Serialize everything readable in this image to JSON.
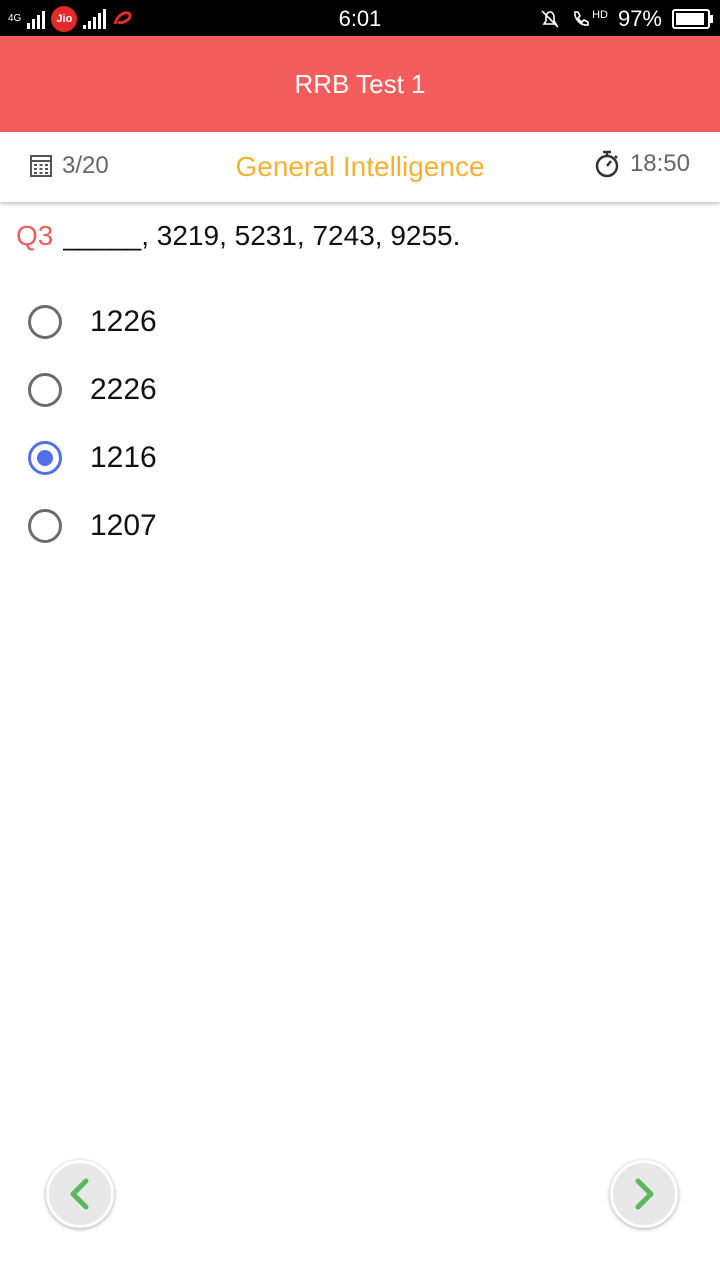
{
  "status_bar": {
    "network_type": "4G",
    "carrier_badge": "Jio",
    "time": "6:01",
    "call_badge": "HD",
    "battery": "97%"
  },
  "app_bar": {
    "title": "RRB Test 1"
  },
  "sub_bar": {
    "question_count": "3/20",
    "section": "General Intelligence",
    "timer": "18:50"
  },
  "question": {
    "number": "Q3",
    "text": "_____, 3219, 5231, 7243, 9255."
  },
  "options": [
    {
      "label": "1226",
      "selected": false
    },
    {
      "label": "2226",
      "selected": false
    },
    {
      "label": "1216",
      "selected": true
    },
    {
      "label": "1207",
      "selected": false
    }
  ],
  "colors": {
    "primary": "#f55d5d",
    "section_accent": "#f6b132",
    "radio_selected": "#5270e8",
    "nav_arrow": "#5cb85c"
  },
  "icons": {
    "question_count": "calculator-grid-icon",
    "timer": "stopwatch-icon",
    "prev": "chevron-left-icon",
    "next": "chevron-right-icon"
  }
}
